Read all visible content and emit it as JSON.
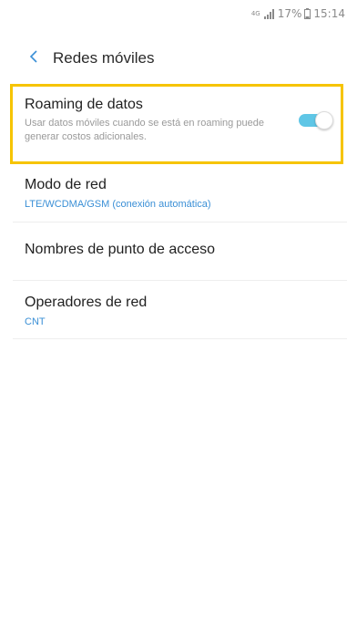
{
  "status_bar": {
    "network_type": "4G",
    "battery_percent": "17%",
    "time": "15:14",
    "icons": [
      "network-type-icon",
      "signal-icon",
      "battery-icon"
    ]
  },
  "header": {
    "back_icon": "chevron-left-icon",
    "title": "Redes móviles"
  },
  "settings": {
    "roaming": {
      "title": "Roaming de datos",
      "description": "Usar datos móviles cuando se está en roaming puede generar costos adicionales.",
      "enabled": true
    },
    "network_mode": {
      "title": "Modo de red",
      "value": "LTE/WCDMA/GSM (conexión automática)"
    },
    "apn": {
      "title": "Nombres de punto de acceso"
    },
    "operators": {
      "title": "Operadores de red",
      "value": "CNT"
    }
  },
  "colors": {
    "accent": "#3a8fd6",
    "toggle_on": "#5fc6e6",
    "highlight_border": "#f6c400",
    "secondary_text": "#9a9a9a"
  }
}
